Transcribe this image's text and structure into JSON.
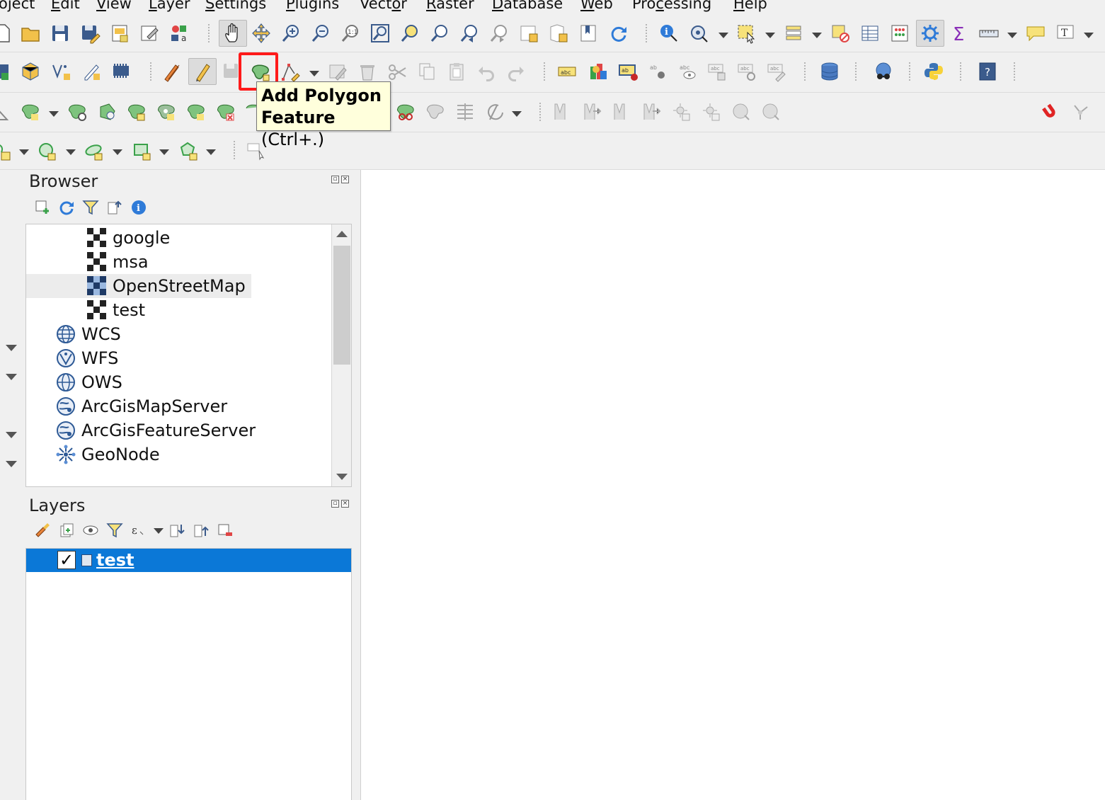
{
  "menu": {
    "items": [
      {
        "label": "oject",
        "ul": ""
      },
      {
        "label": "Edit",
        "ul": "E"
      },
      {
        "label": "View",
        "ul": "V"
      },
      {
        "label": "Layer",
        "ul": "L"
      },
      {
        "label": "Settings",
        "ul": "S"
      },
      {
        "label": "Plugins",
        "ul": "P"
      },
      {
        "label": "Vector",
        "ul": "o"
      },
      {
        "label": "Raster",
        "ul": "R"
      },
      {
        "label": "Database",
        "ul": "D"
      },
      {
        "label": "Web",
        "ul": "W"
      },
      {
        "label": "Processing",
        "ul": "c"
      },
      {
        "label": "Help",
        "ul": "H"
      }
    ]
  },
  "tooltip": {
    "title_line1": "Add Polygon",
    "title_line2": "Feature",
    "shortcut": "(Ctrl+.)"
  },
  "colors": {
    "highlight": "#ff1a1a",
    "selection": "#0b78d7",
    "tooltip_bg": "#ffffdc"
  },
  "browser": {
    "title": "Browser",
    "items": [
      {
        "label": "google",
        "icon": "xyz-tile-icon",
        "level": 2
      },
      {
        "label": "msa",
        "icon": "xyz-tile-icon",
        "level": 2
      },
      {
        "label": "OpenStreetMap",
        "icon": "xyz-tile-icon",
        "level": 2,
        "selected": true
      },
      {
        "label": "test",
        "icon": "xyz-tile-icon",
        "level": 2
      },
      {
        "label": "WCS",
        "icon": "globe-icon",
        "level": 1
      },
      {
        "label": "WFS",
        "icon": "globe-icon",
        "level": 1
      },
      {
        "label": "OWS",
        "icon": "globe-icon",
        "level": 1
      },
      {
        "label": "ArcGisMapServer",
        "icon": "globe-icon",
        "level": 1
      },
      {
        "label": "ArcGisFeatureServer",
        "icon": "globe-icon",
        "level": 1
      },
      {
        "label": "GeoNode",
        "icon": "geonode-icon",
        "level": 1
      }
    ]
  },
  "layers": {
    "title": "Layers",
    "items": [
      {
        "label": "test",
        "checked": true,
        "selected": true
      }
    ]
  }
}
